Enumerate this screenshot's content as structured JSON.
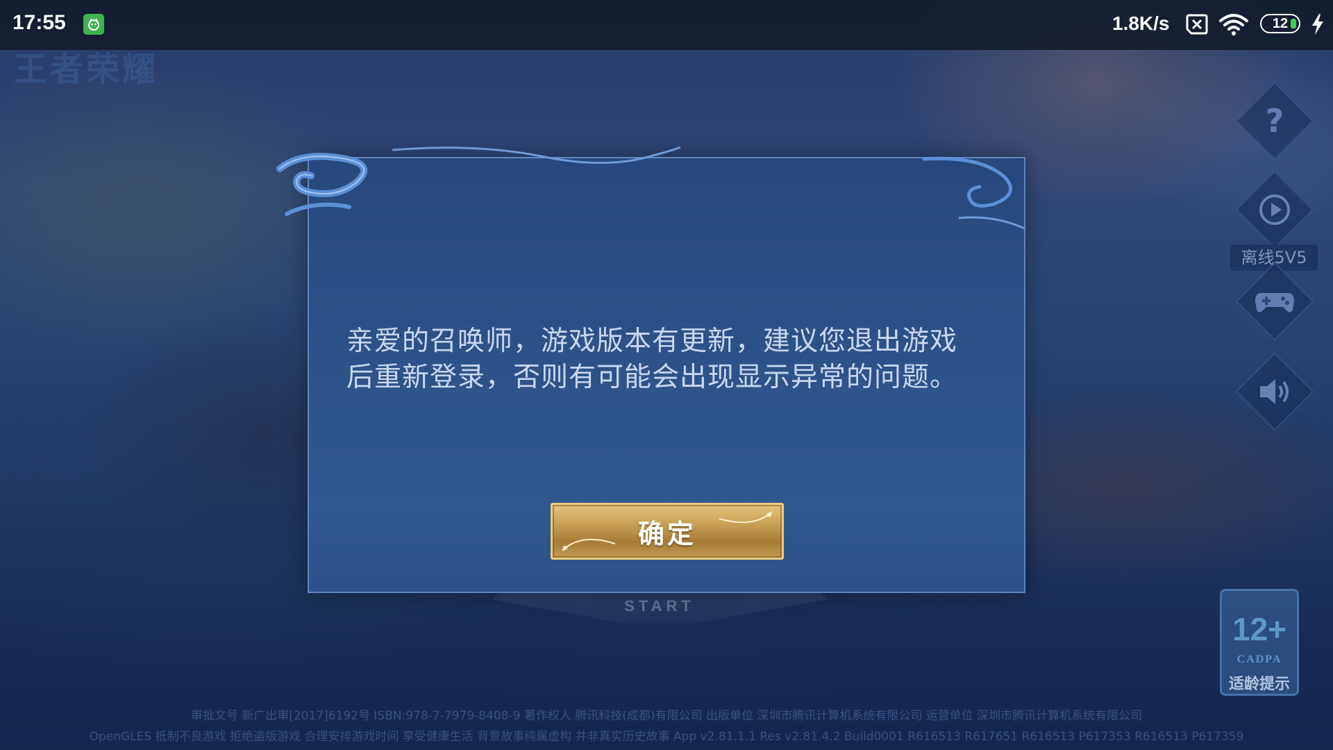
{
  "status_bar": {
    "time": "17:55",
    "net_speed": "1.8K/s",
    "battery_level": "12",
    "app_icon": "cat-face-icon",
    "icons": [
      "sim-cancel-icon",
      "wifi-icon",
      "battery-icon",
      "charging-bolt-icon"
    ]
  },
  "game": {
    "logo_text": "王者荣耀",
    "start_label": "START"
  },
  "side_menu": {
    "items": [
      {
        "icon": "help-icon",
        "glyph": "?"
      },
      {
        "icon": "play-replay-icon",
        "label": "离线5V5"
      },
      {
        "icon": "gamepad-icon"
      },
      {
        "icon": "volume-icon"
      }
    ]
  },
  "age_badge": {
    "rating": "12+",
    "org": "CADPA",
    "hint": "适龄提示"
  },
  "footer": {
    "line1": "审批文号 新广出审[2017]6192号 ISBN:978-7-7979-8408-9 著作权人 腾讯科技(成都)有限公司 出版单位 深圳市腾讯计算机系统有限公司 运营单位 深圳市腾讯计算机系统有限公司",
    "line2": "OpenGLES 抵制不良游戏 拒绝盗版游戏 合理安排游戏时间 享受健康生活 背景故事纯属虚构 并非真实历史故事 App v2.81.1.1 Res v2.81.4.2 Build0001 R616513 R617651 R616513 P617353 R616513 P617359"
  },
  "dialog": {
    "message": "亲爱的召唤师，游戏版本有更新，建议您退出游戏\n后重新登录，否则有可能会出现显示异常的问题。",
    "confirm_label": "确定"
  },
  "colors": {
    "dialog_bg": "#2c5186",
    "dialog_border": "#5f86bd",
    "button_gold": "#c9a257",
    "text_light": "#c9d8ef"
  }
}
